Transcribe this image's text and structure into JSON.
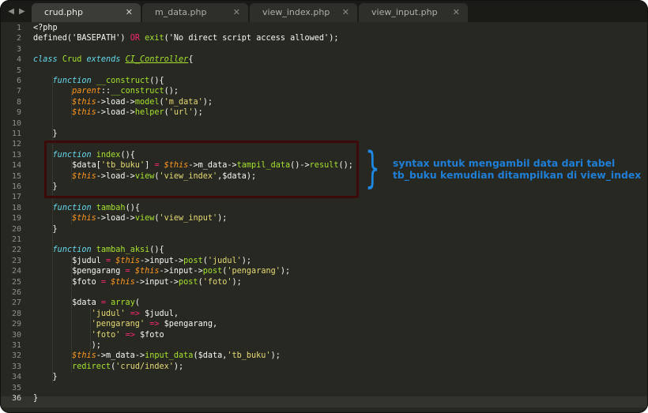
{
  "tabs": [
    {
      "label": "crud.php",
      "active": true
    },
    {
      "label": "m_data.php",
      "active": false
    },
    {
      "label": "view_index.php",
      "active": false
    },
    {
      "label": "view_input.php",
      "active": false
    }
  ],
  "nav": {
    "back_icon": "chevron-left-icon",
    "forward_icon": "chevron-right-icon"
  },
  "close_glyph": "✕",
  "line_numbers": [
    "1",
    "2",
    "3",
    "4",
    "5",
    "6",
    "7",
    "8",
    "9",
    "10",
    "11",
    "12",
    "13",
    "14",
    "15",
    "16",
    "17",
    "18",
    "19",
    "20",
    "21",
    "22",
    "23",
    "24",
    "25",
    "26",
    "27",
    "28",
    "29",
    "30",
    "31",
    "32",
    "33",
    "34",
    "35",
    "36"
  ],
  "current_line": "36",
  "code": [
    [
      [
        "plain",
        "<?php"
      ]
    ],
    [
      [
        "plain",
        "defined('"
      ],
      [
        "plain",
        "BASEPATH"
      ],
      [
        "plain",
        "') "
      ],
      [
        "op",
        "OR"
      ],
      [
        "plain",
        " "
      ],
      [
        "fn",
        "exit"
      ],
      [
        "plain",
        "('No direct script access allowed');"
      ]
    ],
    [],
    [
      [
        "kw",
        "class"
      ],
      [
        "plain",
        " "
      ],
      [
        "fn",
        "Crud"
      ],
      [
        "plain",
        " "
      ],
      [
        "kw",
        "extends"
      ],
      [
        "plain",
        " "
      ],
      [
        "cls",
        "CI_Controller"
      ],
      [
        "plain",
        "{"
      ]
    ],
    [],
    [
      [
        "plain",
        "    "
      ],
      [
        "kw",
        "function"
      ],
      [
        "plain",
        " "
      ],
      [
        "fn",
        "__construct"
      ],
      [
        "plain",
        "(){"
      ]
    ],
    [
      [
        "plain",
        "        "
      ],
      [
        "var",
        "parent"
      ],
      [
        "plain",
        "::"
      ],
      [
        "fn",
        "__construct"
      ],
      [
        "plain",
        "();"
      ]
    ],
    [
      [
        "plain",
        "        "
      ],
      [
        "var",
        "$this"
      ],
      [
        "plain",
        "->load->"
      ],
      [
        "fn",
        "model"
      ],
      [
        "plain",
        "("
      ],
      [
        "str",
        "'m_data'"
      ],
      [
        "plain",
        ");"
      ]
    ],
    [
      [
        "plain",
        "        "
      ],
      [
        "var",
        "$this"
      ],
      [
        "plain",
        "->load->"
      ],
      [
        "fn",
        "helper"
      ],
      [
        "plain",
        "("
      ],
      [
        "str",
        "'url'"
      ],
      [
        "plain",
        ");"
      ]
    ],
    [],
    [
      [
        "plain",
        "    }"
      ]
    ],
    [],
    [
      [
        "plain",
        "    "
      ],
      [
        "kw",
        "function"
      ],
      [
        "plain",
        " "
      ],
      [
        "fn",
        "index"
      ],
      [
        "plain",
        "(){"
      ]
    ],
    [
      [
        "plain",
        "        $data["
      ],
      [
        "str",
        "'tb_buku'"
      ],
      [
        "plain",
        "] "
      ],
      [
        "op",
        "="
      ],
      [
        "plain",
        " "
      ],
      [
        "var",
        "$this"
      ],
      [
        "plain",
        "->m_data->"
      ],
      [
        "fn",
        "tampil_data"
      ],
      [
        "plain",
        "()->"
      ],
      [
        "fn",
        "result"
      ],
      [
        "plain",
        "();"
      ]
    ],
    [
      [
        "plain",
        "        "
      ],
      [
        "var",
        "$this"
      ],
      [
        "plain",
        "->load->"
      ],
      [
        "fn",
        "view"
      ],
      [
        "plain",
        "("
      ],
      [
        "str",
        "'view_index'"
      ],
      [
        "plain",
        ",$data);"
      ]
    ],
    [
      [
        "plain",
        "    }"
      ]
    ],
    [],
    [
      [
        "plain",
        "    "
      ],
      [
        "kw",
        "function"
      ],
      [
        "plain",
        " "
      ],
      [
        "fn",
        "tambah"
      ],
      [
        "plain",
        "(){"
      ]
    ],
    [
      [
        "plain",
        "        "
      ],
      [
        "var",
        "$this"
      ],
      [
        "plain",
        "->load->"
      ],
      [
        "fn",
        "view"
      ],
      [
        "plain",
        "("
      ],
      [
        "str",
        "'view_input'"
      ],
      [
        "plain",
        ");"
      ]
    ],
    [
      [
        "plain",
        "    }"
      ]
    ],
    [],
    [
      [
        "plain",
        "    "
      ],
      [
        "kw",
        "function"
      ],
      [
        "plain",
        " "
      ],
      [
        "fn",
        "tambah_aksi"
      ],
      [
        "plain",
        "(){"
      ]
    ],
    [
      [
        "plain",
        "        $judul "
      ],
      [
        "op",
        "="
      ],
      [
        "plain",
        " "
      ],
      [
        "var",
        "$this"
      ],
      [
        "plain",
        "->input->"
      ],
      [
        "fn",
        "post"
      ],
      [
        "plain",
        "("
      ],
      [
        "str",
        "'judul'"
      ],
      [
        "plain",
        ");"
      ]
    ],
    [
      [
        "plain",
        "        $pengarang "
      ],
      [
        "op",
        "="
      ],
      [
        "plain",
        " "
      ],
      [
        "var",
        "$this"
      ],
      [
        "plain",
        "->input->"
      ],
      [
        "fn",
        "post"
      ],
      [
        "plain",
        "("
      ],
      [
        "str",
        "'pengarang'"
      ],
      [
        "plain",
        ");"
      ]
    ],
    [
      [
        "plain",
        "        $foto "
      ],
      [
        "op",
        "="
      ],
      [
        "plain",
        " "
      ],
      [
        "var",
        "$this"
      ],
      [
        "plain",
        "->input->"
      ],
      [
        "fn",
        "post"
      ],
      [
        "plain",
        "("
      ],
      [
        "str",
        "'foto'"
      ],
      [
        "plain",
        ");"
      ]
    ],
    [],
    [
      [
        "plain",
        "        $data "
      ],
      [
        "op",
        "="
      ],
      [
        "plain",
        " "
      ],
      [
        "fn",
        "array"
      ],
      [
        "plain",
        "("
      ]
    ],
    [
      [
        "plain",
        "            "
      ],
      [
        "str",
        "'judul'"
      ],
      [
        "plain",
        " "
      ],
      [
        "op",
        "=>"
      ],
      [
        "plain",
        " $judul,"
      ]
    ],
    [
      [
        "plain",
        "            "
      ],
      [
        "str",
        "'pengarang'"
      ],
      [
        "plain",
        " "
      ],
      [
        "op",
        "=>"
      ],
      [
        "plain",
        " $pengarang,"
      ]
    ],
    [
      [
        "plain",
        "            "
      ],
      [
        "str",
        "'foto'"
      ],
      [
        "plain",
        " "
      ],
      [
        "op",
        "=>"
      ],
      [
        "plain",
        " $foto"
      ]
    ],
    [
      [
        "plain",
        "            );"
      ]
    ],
    [
      [
        "plain",
        "        "
      ],
      [
        "var",
        "$this"
      ],
      [
        "plain",
        "->m_data->"
      ],
      [
        "fn",
        "input_data"
      ],
      [
        "plain",
        "($data,"
      ],
      [
        "str",
        "'tb_buku'"
      ],
      [
        "plain",
        ");"
      ]
    ],
    [
      [
        "plain",
        "        "
      ],
      [
        "fn",
        "redirect"
      ],
      [
        "plain",
        "("
      ],
      [
        "str",
        "'crud/index'"
      ],
      [
        "plain",
        ");"
      ]
    ],
    [
      [
        "plain",
        "    }"
      ]
    ],
    [],
    [
      [
        "plain",
        "}"
      ]
    ]
  ],
  "annotation": {
    "line1": "syntax untuk mengambil data dari tabel",
    "line2": "tb_buku kemudian ditampilkan di view_index"
  },
  "colors": {
    "background": "#272822",
    "keyword": "#66d9ef",
    "operator": "#f92672",
    "function": "#a6e22e",
    "string": "#e6db74",
    "variable": "#fd971f",
    "annotation": "#1f7fd6",
    "highlight_box": "#3d0a0a"
  }
}
